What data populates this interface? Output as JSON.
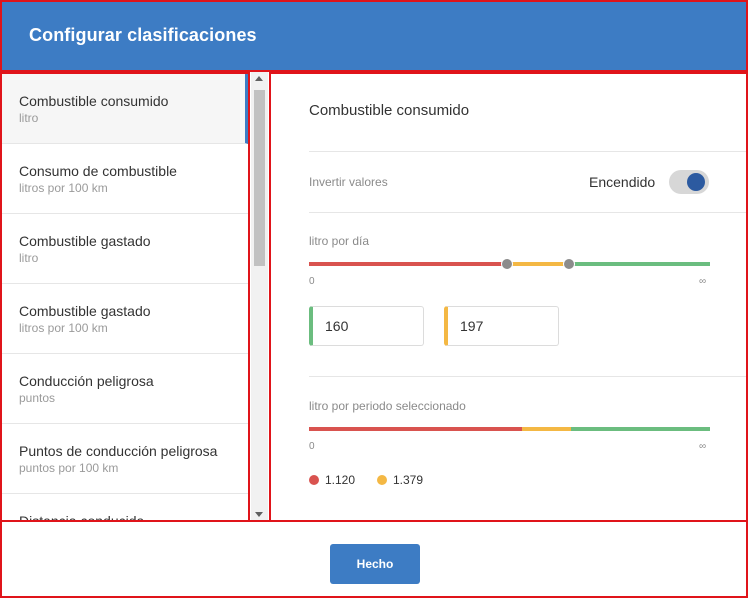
{
  "header": {
    "title": "Configurar clasificaciones"
  },
  "sidebar": {
    "items": [
      {
        "name": "Combustible consumido",
        "unit": "litro",
        "active": true
      },
      {
        "name": "Consumo de combustible",
        "unit": "litros por 100 km"
      },
      {
        "name": "Combustible gastado",
        "unit": "litro"
      },
      {
        "name": "Combustible gastado",
        "unit": "litros por 100 km"
      },
      {
        "name": "Conducción peligrosa",
        "unit": "puntos"
      },
      {
        "name": "Puntos de conducción peligrosa",
        "unit": "puntos por 100 km"
      },
      {
        "name": "Distancia conducida",
        "unit": ""
      }
    ]
  },
  "main": {
    "title": "Combustible consumido",
    "invert": {
      "label": "Invertir valores",
      "state": "Encendido",
      "on": true
    },
    "per_day": {
      "label": "litro por día",
      "min_label": "0",
      "max_label": "∞",
      "threshold_1": "160",
      "threshold_2": "197"
    },
    "per_period": {
      "label": "litro por periodo seleccionado",
      "min_label": "0",
      "max_label": "∞",
      "legend_red": "1.120",
      "legend_yellow": "1.379"
    }
  },
  "footer": {
    "done_label": "Hecho"
  },
  "colors": {
    "header": "#3d7cc4",
    "red": "#d9534f",
    "yellow": "#f4b844",
    "green": "#6bbd7f",
    "toggle_knob": "#2c5aa0"
  }
}
